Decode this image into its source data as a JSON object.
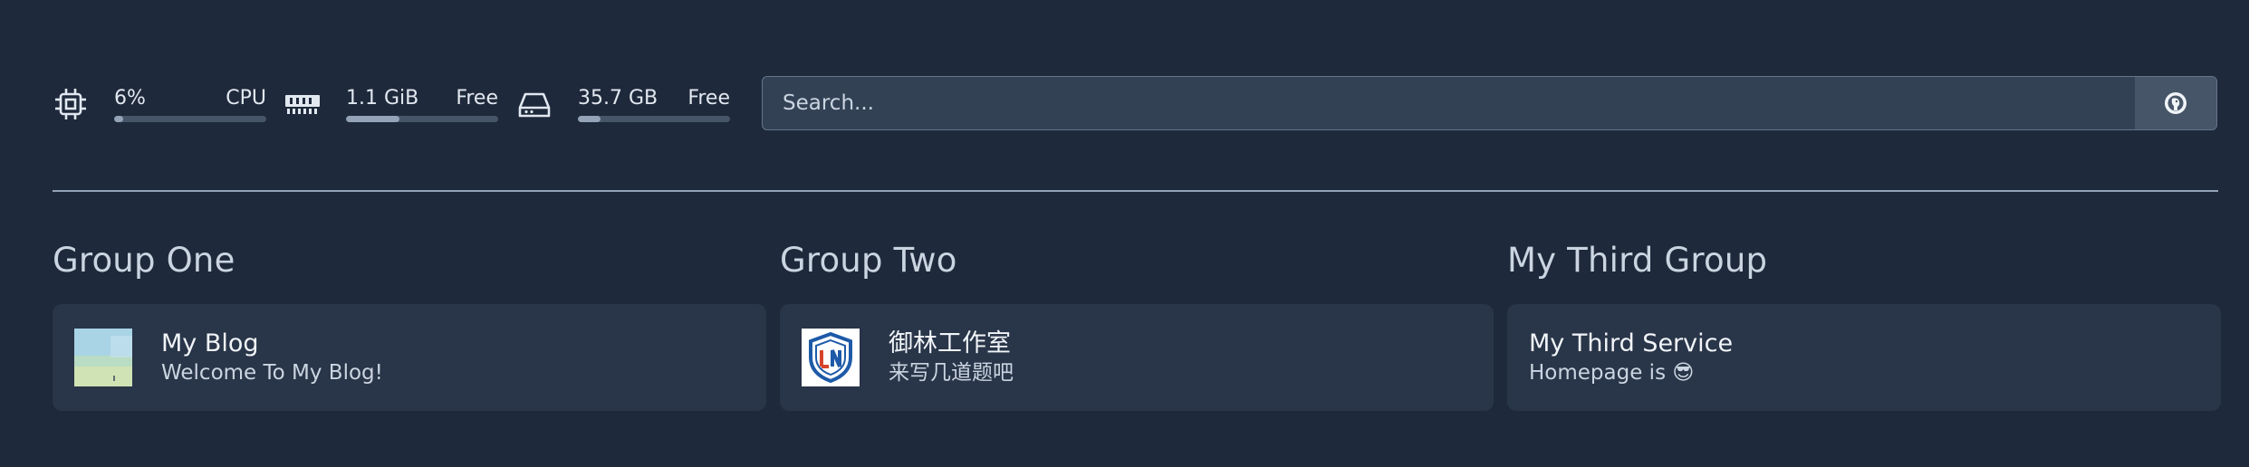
{
  "resources": {
    "cpu": {
      "value": "6%",
      "label": "CPU",
      "usage_fraction": 0.06,
      "icon": "cpu-icon"
    },
    "memory": {
      "value": "1.1 GiB",
      "label": "Free",
      "usage_fraction": 0.35,
      "icon": "memory-icon"
    },
    "disk": {
      "value": "35.7 GB",
      "label": "Free",
      "usage_fraction": 0.15,
      "icon": "disk-icon"
    }
  },
  "search": {
    "placeholder": "Search...",
    "icon": "duckduckgo-icon"
  },
  "groups": [
    {
      "title": "Group One",
      "services": [
        {
          "name": "My Blog",
          "description": "Welcome To My Blog!",
          "icon": "landscape-thumbnail"
        }
      ]
    },
    {
      "title": "Group Two",
      "services": [
        {
          "name": "御林工作室",
          "description": "来写几道题吧",
          "icon": "shield-logo"
        }
      ]
    },
    {
      "title": "My Third Group",
      "services": [
        {
          "name": "My Third Service",
          "description": "Homepage is 😎"
        }
      ]
    }
  ],
  "colors": {
    "background": "#1e293b",
    "card": "#293548",
    "bar_track": "#475569",
    "bar_fill": "#94a3b8"
  }
}
